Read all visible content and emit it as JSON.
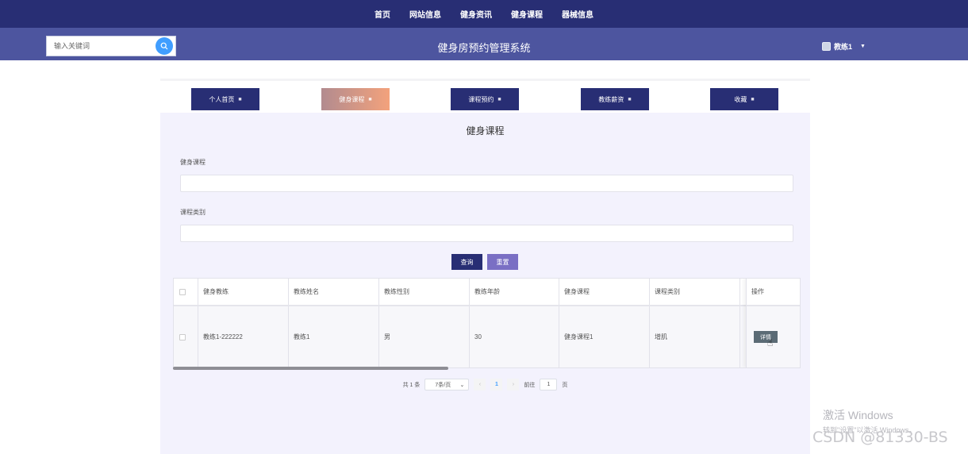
{
  "topnav": [
    "首页",
    "网站信息",
    "健身资讯",
    "健身课程",
    "器械信息"
  ],
  "header": {
    "search_placeholder": "输入关键词",
    "site_title": "健身房预约管理系统",
    "username": "教练1"
  },
  "tabs": [
    {
      "label": "个人首页",
      "active": false
    },
    {
      "label": "健身课程",
      "active": true
    },
    {
      "label": "课程预约",
      "active": false
    },
    {
      "label": "教练薪资",
      "active": false
    },
    {
      "label": "收藏",
      "active": false
    }
  ],
  "panel": {
    "title": "健身课程",
    "filters": [
      {
        "label": "健身课程",
        "value": ""
      },
      {
        "label": "课程类别",
        "value": ""
      }
    ],
    "query_button": "查询",
    "reset_button": "重置"
  },
  "table": {
    "columns": [
      "健身教练",
      "教练姓名",
      "教练性别",
      "教练年龄",
      "健身课程",
      "课程类别"
    ],
    "action_column": "操作",
    "rows": [
      [
        "教练1-222222",
        "教练1",
        "男",
        "30",
        "健身课程1",
        "增肌"
      ]
    ],
    "detail_button": "详情"
  },
  "pagination": {
    "total": "共 1 条",
    "page_size": "7条/页",
    "current_page": "1",
    "goto_label": "前往",
    "goto_value": "1",
    "page_unit": "页"
  },
  "watermark": {
    "line1": "激活 Windows",
    "line2": "转到\"设置\"以激活 Windows。",
    "csdn": "CSDN @81330-BS"
  },
  "colors": {
    "nav_bg": "#282e74",
    "header_bg": "#4d559f",
    "content_bg": "#f3f2fd",
    "query_btn": "#282e74",
    "reset_btn": "#7a6fc4",
    "search_btn": "#409eff"
  }
}
